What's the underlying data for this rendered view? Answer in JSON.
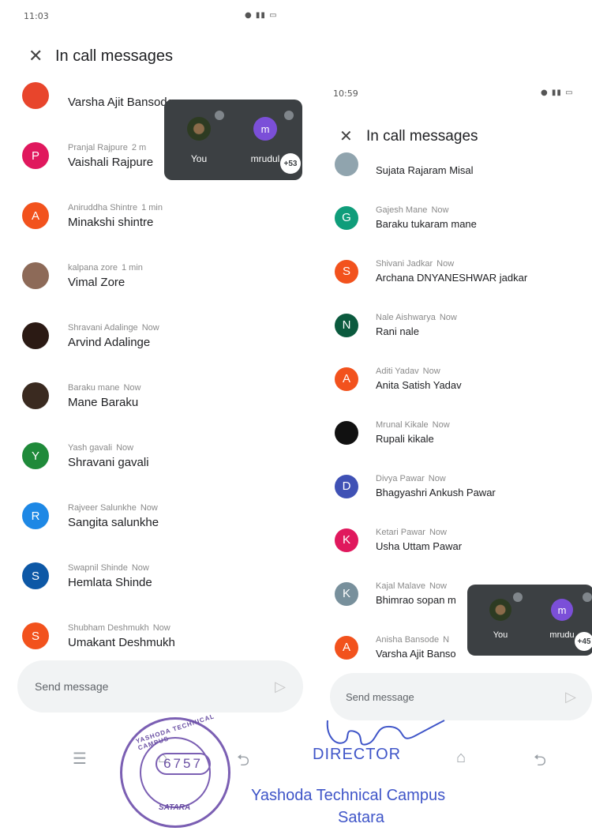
{
  "left": {
    "status_time": "11:03",
    "title": "In call messages",
    "messages": [
      {
        "sender": "",
        "time": "",
        "body": "Varsha Ajit Bansode",
        "avatar": "",
        "color": "#e8452c"
      },
      {
        "sender": "Pranjal Rajpure",
        "time": "2 m",
        "body": "Vaishali Rajpure",
        "avatar": "P",
        "color": "#e0185d"
      },
      {
        "sender": "Aniruddha Shintre",
        "time": "1 min",
        "body": "Minakshi shintre",
        "avatar": "A",
        "color": "#f2521d"
      },
      {
        "sender": "kalpana zore",
        "time": "1 min",
        "body": "Vimal Zore",
        "avatar": "",
        "color": "#8d6a58"
      },
      {
        "sender": "Shravani Adalinge",
        "time": "Now",
        "body": "Arvind Adalinge",
        "avatar": "",
        "color": "#2b1a14"
      },
      {
        "sender": "Baraku mane",
        "time": "Now",
        "body": "Mane Baraku",
        "avatar": "",
        "color": "#3a2a20"
      },
      {
        "sender": "Yash gavali",
        "time": "Now",
        "body": "Shravani gavali",
        "avatar": "Y",
        "color": "#1f8a3a"
      },
      {
        "sender": "Rajveer Salunkhe",
        "time": "Now",
        "body": "Sangita salunkhe",
        "avatar": "R",
        "color": "#1e88e5"
      },
      {
        "sender": "Swapnil Shinde",
        "time": "Now",
        "body": "Hemlata Shinde",
        "avatar": "S",
        "color": "#0d58a6"
      },
      {
        "sender": "Shubham Deshmukh",
        "time": "Now",
        "body": "Umakant Deshmukh",
        "avatar": "S",
        "color": "#f2521d"
      }
    ],
    "send_placeholder": "Send message",
    "pip": {
      "self_label": "You",
      "other_label": "mrudul",
      "other_initial": "m",
      "more": "+53"
    }
  },
  "right": {
    "status_time": "10:59",
    "title": "In call messages",
    "messages": [
      {
        "sender": "",
        "time": "",
        "body": "Sujata Rajaram Misal",
        "avatar": "",
        "color": "#90a4ae"
      },
      {
        "sender": "Gajesh Mane",
        "time": "Now",
        "body": "Baraku tukaram mane",
        "avatar": "G",
        "color": "#0f9d7a"
      },
      {
        "sender": "Shivani Jadkar",
        "time": "Now",
        "body": "Archana DNYANESHWAR jadkar",
        "avatar": "S",
        "color": "#f2521d"
      },
      {
        "sender": "Nale Aishwarya",
        "time": "Now",
        "body": "Rani nale",
        "avatar": "N",
        "color": "#0b5a3e"
      },
      {
        "sender": "Aditi Yadav",
        "time": "Now",
        "body": "Anita Satish Yadav",
        "avatar": "A",
        "color": "#f2521d"
      },
      {
        "sender": "Mrunal Kikale",
        "time": "Now",
        "body": "Rupali kikale",
        "avatar": "",
        "color": "#111111"
      },
      {
        "sender": "Divya Pawar",
        "time": "Now",
        "body": "Bhagyashri Ankush Pawar",
        "avatar": "D",
        "color": "#3f51b5"
      },
      {
        "sender": "Ketari Pawar",
        "time": "Now",
        "body": "Usha Uttam Pawar",
        "avatar": "K",
        "color": "#e0185d"
      },
      {
        "sender": "Kajal Malave",
        "time": "Now",
        "body": "Bhimrao sopan m",
        "avatar": "K",
        "color": "#78909c"
      },
      {
        "sender": "Anisha Bansode",
        "time": "N",
        "body": "Varsha Ajit Banso",
        "avatar": "A",
        "color": "#f2521d"
      }
    ],
    "send_placeholder": "Send message",
    "pip": {
      "self_label": "You",
      "other_label": "mrudu",
      "other_initial": "m",
      "more": "+45"
    }
  },
  "stamp": {
    "number": "6757",
    "top_text": "YASHODA TECHNICAL CAMPUS",
    "bottom_text": "SATARA",
    "director": "DIRECTOR",
    "campus": "Yashoda Technical Campus",
    "city": "Satara"
  }
}
